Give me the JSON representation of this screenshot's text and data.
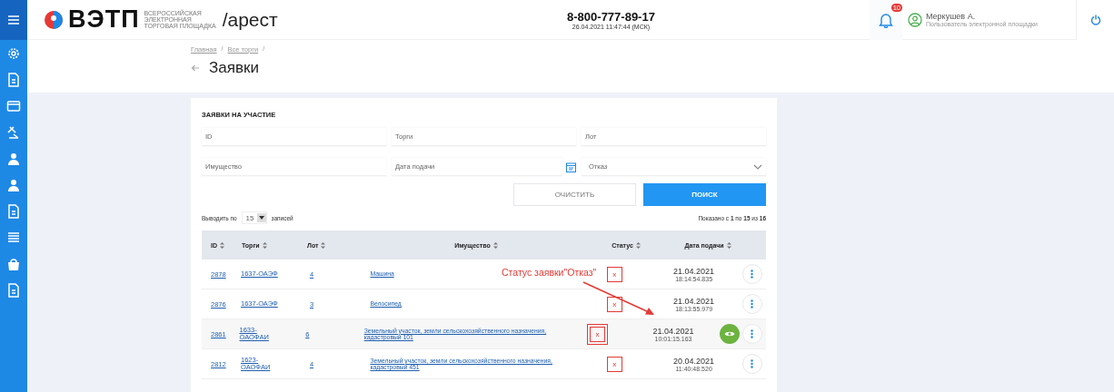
{
  "header": {
    "logo_text": "ВЭТП",
    "logo_subtitle": [
      "ВСЕРОССИЙСКАЯ",
      "ЭЛЕКТРОННАЯ",
      "ТОРГОВАЯ ПЛОЩАДКА"
    ],
    "section": "/арест",
    "phone": "8-800-777-89-17",
    "datetime": "26.04.2021 11:47:44 (МСК)",
    "notifications_badge": "10",
    "user_name": "Меркушев А.",
    "user_role": "Пользователь электронной площадки"
  },
  "breadcrumbs": [
    "Главная",
    "Все торги"
  ],
  "breadcrumb_separator": "/",
  "page_title": "Заявки",
  "card_title": "ЗАЯВКИ НА УЧАСТИЕ",
  "filters": [
    {
      "kind": "text",
      "placeholder": "ID"
    },
    {
      "kind": "text",
      "placeholder": "Торги"
    },
    {
      "kind": "text",
      "placeholder": "Лот"
    },
    {
      "kind": "text",
      "placeholder": "Имущество"
    },
    {
      "kind": "date",
      "placeholder": "Дата подачи"
    },
    {
      "kind": "select",
      "value": "Отказ"
    }
  ],
  "buttons": [
    {
      "label": "ОЧИСТИТЬ",
      "kind": "secondary"
    },
    {
      "label": "ПОИСК",
      "kind": "primary"
    }
  ],
  "page_size": {
    "label_before": "Выводить по",
    "value": "15",
    "label_after": "записей"
  },
  "summary": "Показано с **1** по **15** из **16**",
  "columns": [
    "ID",
    "Торги",
    "Лот",
    "Имущество",
    "Статус",
    "Дата подачи"
  ],
  "rows": [
    {
      "id": "2878",
      "auction": [
        "1637-ОАЭФ"
      ],
      "lot": "4",
      "property": [
        "Машина"
      ],
      "status": "x",
      "date": "21.04.2021",
      "time": "18:14:54.835",
      "highlighted": false,
      "view_button": false,
      "annotated": false
    },
    {
      "id": "2876",
      "auction": [
        "1637-ОАЭФ"
      ],
      "lot": "3",
      "property": [
        "Велосипед"
      ],
      "status": "x",
      "date": "21.04.2021",
      "time": "18:13:55.979",
      "highlighted": false,
      "view_button": false,
      "annotated": false
    },
    {
      "id": "2861",
      "auction": [
        "1633-",
        "ОАОФАИ"
      ],
      "lot": "6",
      "property": [
        "Земельный участок, земли сельскохозяйственного назначения,",
        "кадастровый 101"
      ],
      "status": "x",
      "date": "21.04.2021",
      "time": "10:01:15.163",
      "highlighted": true,
      "view_button": true,
      "annotated": true
    },
    {
      "id": "2812",
      "auction": [
        "1623-",
        "ОАОФАИ"
      ],
      "lot": "4",
      "property": [
        "Земельный участок, земли сельскохозяйственного назначения,",
        "кадастровый 451"
      ],
      "status": "x",
      "date": "20.04.2021",
      "time": "11:40:48.520",
      "highlighted": false,
      "view_button": false,
      "annotated": false
    }
  ],
  "annotation": {
    "text": "Статус заявки\"Отказ\""
  }
}
